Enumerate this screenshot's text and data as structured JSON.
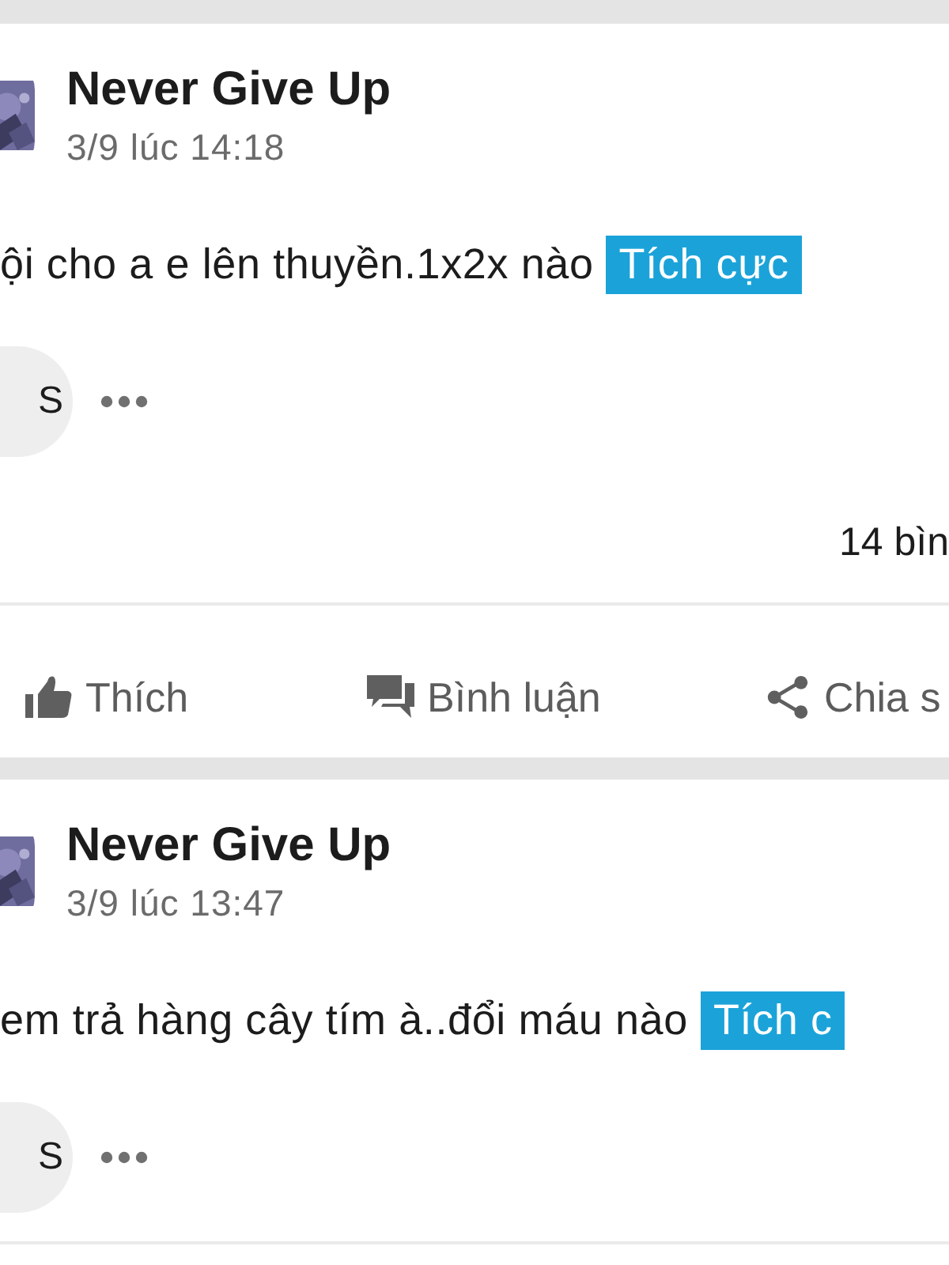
{
  "posts": [
    {
      "author": "Never Give Up",
      "time": "3/9 lúc 14:18",
      "text": "ội cho a e lên thuyền.1x2x nào",
      "tag": "Tích cực",
      "reaction_letter": "S",
      "comment_count": "14 bìn",
      "actions": [
        {
          "kind": "like",
          "label": "Thích"
        },
        {
          "kind": "comment",
          "label": "Bình luận"
        },
        {
          "kind": "share",
          "label": "Chia s"
        }
      ]
    },
    {
      "author": "Never Give Up",
      "time": "3/9 lúc 13:47",
      "text": "em trả hàng cây tím à..đổi máu nào",
      "tag": "Tích c",
      "reaction_letter": "S"
    }
  ]
}
